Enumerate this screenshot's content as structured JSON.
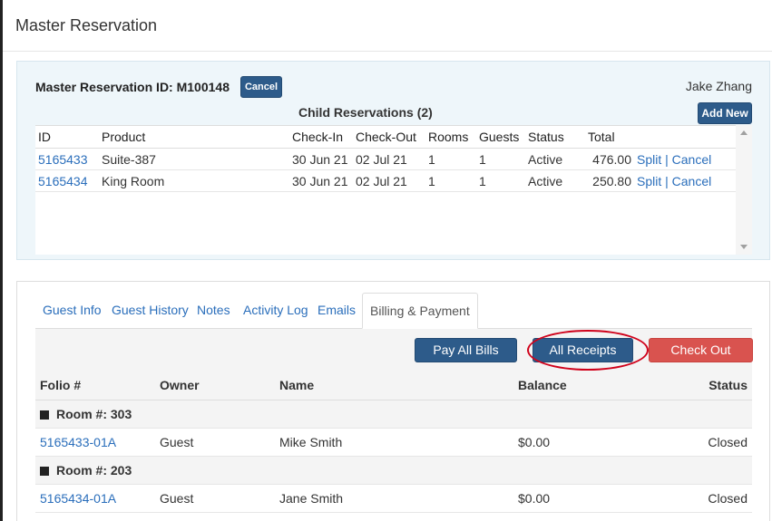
{
  "modal": {
    "title": "Master Reservation"
  },
  "master": {
    "id_label": "Master Reservation ID: M100148",
    "cancel_label": "Cancel",
    "guest_name": "Jake Zhang",
    "child_title": "Child Reservations (2)",
    "add_new_label": "Add New"
  },
  "child_table": {
    "headers": [
      "ID",
      "Product",
      "Check-In",
      "Check-Out",
      "Rooms",
      "Guests",
      "Status",
      "Total"
    ],
    "rows": [
      {
        "id": "5165433",
        "product": "Suite-387",
        "check_in": "30 Jun 21",
        "check_out": "02 Jul 21",
        "rooms": "1",
        "guests": "1",
        "status": "Active",
        "total": "476.00",
        "split": "Split",
        "sep": "|",
        "cancel": "Cancel"
      },
      {
        "id": "5165434",
        "product": "King Room",
        "check_in": "30 Jun 21",
        "check_out": "02 Jul 21",
        "rooms": "1",
        "guests": "1",
        "status": "Active",
        "total": "250.80",
        "split": "Split",
        "sep": "|",
        "cancel": "Cancel"
      }
    ]
  },
  "tabs": [
    "Guest Info",
    "Guest History",
    "Notes",
    "Activity Log",
    "Emails",
    "Billing & Payment"
  ],
  "actions": {
    "pay_all": "Pay All Bills",
    "all_receipts": "All Receipts",
    "check_out": "Check Out"
  },
  "folio_table": {
    "headers": [
      "Folio #",
      "Owner",
      "Name",
      "Balance",
      "Status"
    ],
    "groups": [
      {
        "label": "Room #: 303",
        "folio": "5165433-01A",
        "owner": "Guest",
        "name": "Mike Smith",
        "balance": "$0.00",
        "status": "Closed"
      },
      {
        "label": "Room #: 203",
        "folio": "5165434-01A",
        "owner": "Guest",
        "name": "Jane Smith",
        "balance": "$0.00",
        "status": "Closed"
      }
    ]
  },
  "colors": {
    "primary": "#2d5b8a",
    "danger": "#d9534f",
    "link": "#2a6ebb",
    "highlight": "#d0021b"
  }
}
